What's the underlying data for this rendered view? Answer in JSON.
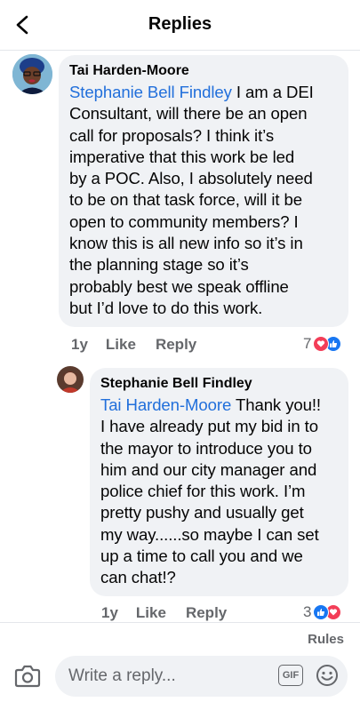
{
  "header": {
    "title": "Replies"
  },
  "comments": [
    {
      "author": "Tai Harden-Moore",
      "mention": "Stephanie Bell Findley",
      "lines": [
        " I am a DEI",
        "Consultant, will there be an open",
        "call for proposals? I think it’s",
        "imperative that this work be led",
        "by a POC. Also, I absolutely need",
        "to be on that task force, will it be",
        "open to community members? I",
        "know this is all new info so it’s in",
        "the planning stage so it’s",
        "probably best we speak offline",
        "but I’d love to do this work."
      ],
      "time": "1y",
      "like_label": "Like",
      "reply_label": "Reply",
      "reaction_count": "7"
    },
    {
      "author": "Stephanie Bell Findley",
      "mention": "Tai Harden-Moore",
      "lines": [
        " Thank you!!",
        "I have already put my bid in to",
        "the mayor to introduce you to",
        "him and our city manager and",
        "police chief for this work. I’m",
        "pretty pushy and usually get",
        "my way......so maybe I can set",
        "up a time to call you and we",
        "can chat!?"
      ],
      "time": "1y",
      "like_label": "Like",
      "reply_label": "Reply",
      "reaction_count": "3"
    }
  ],
  "rules_label": "Rules",
  "composer": {
    "placeholder": "Write a reply...",
    "gif_label": "GIF"
  },
  "colors": {
    "mention": "#216fdb",
    "like_blue": "#1877f2",
    "love_red": "#f33e58",
    "bubble": "#f0f2f5"
  }
}
